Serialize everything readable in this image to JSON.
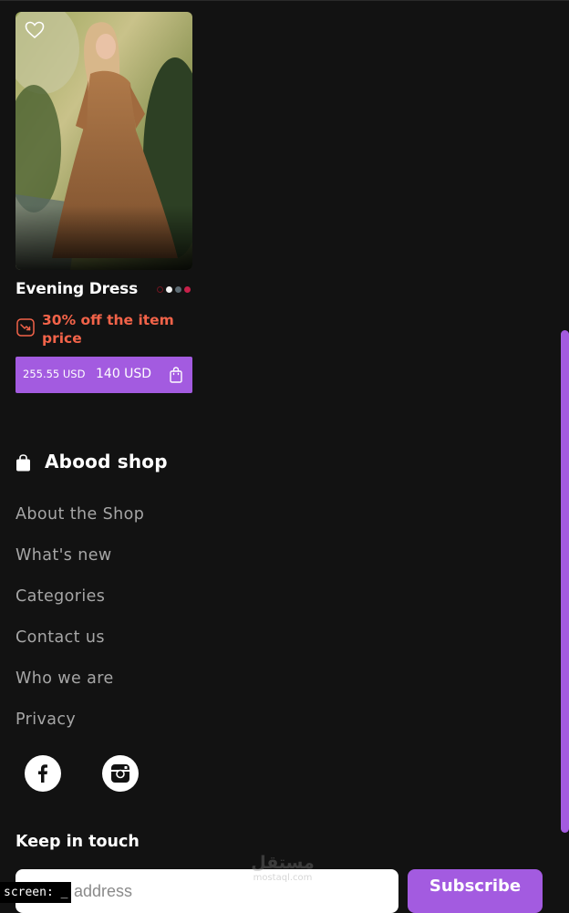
{
  "product": {
    "title": "Evening Dress",
    "swatch_colors": [
      "#6e1620",
      "#f5f5f5",
      "#5d6b73",
      "#c8204a"
    ],
    "discount_text": "30% off the item price",
    "old_price": "255.55 USD",
    "new_price": "140 USD",
    "accent_color": "#a35be0",
    "discount_color": "#f26349"
  },
  "footer": {
    "shop_name": "Abood shop",
    "links": [
      "About the Shop",
      "What's new",
      "Categories",
      "Contact us",
      "Who we are",
      "Privacy"
    ],
    "social": [
      "facebook-icon",
      "instagram-icon"
    ],
    "newsletter": {
      "title": "Keep in touch",
      "input_placeholder": "address",
      "button_label": "Subscribe"
    }
  },
  "watermark": {
    "arabic": "مستقل",
    "latin": "mostaql.com"
  },
  "screen_label": "screen: _"
}
